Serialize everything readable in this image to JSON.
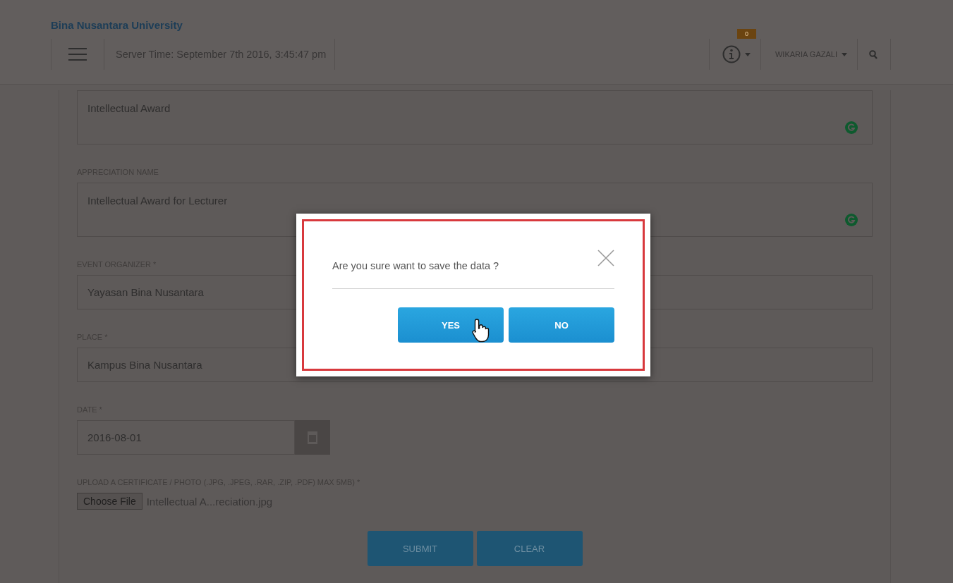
{
  "header": {
    "title": "Bina Nusantara University",
    "server_time": "Server Time: September 7th 2016, 3:45:47 pm",
    "notification_count": "0",
    "user_name": "WIKARIA GAZALI"
  },
  "form": {
    "fields": [
      {
        "kind": "textarea",
        "value": "Intellectual Award"
      },
      {
        "kind": "textarea",
        "label": "APPRECIATION NAME",
        "value": "Intellectual Award for Lecturer"
      },
      {
        "kind": "input",
        "label": "EVENT ORGANIZER *",
        "value": "Yayasan Bina Nusantara"
      },
      {
        "kind": "input",
        "label": "PLACE *",
        "value": "Kampus Bina Nusantara"
      },
      {
        "kind": "date",
        "label": "DATE *",
        "value": "2016-08-01"
      },
      {
        "kind": "file",
        "label": "UPLOAD A CERTIFICATE / PHOTO (.JPG, .JPEG, .RAR, .ZIP, .PDF) MAX 5MB) *",
        "button": "Choose File",
        "file_name": "Intellectual A...reciation.jpg"
      }
    ],
    "buttons": [
      "SUBMIT",
      "CLEAR"
    ]
  },
  "dialog": {
    "message": "Are you sure want to save the data ?",
    "buttons": [
      "YES",
      "NO"
    ]
  }
}
